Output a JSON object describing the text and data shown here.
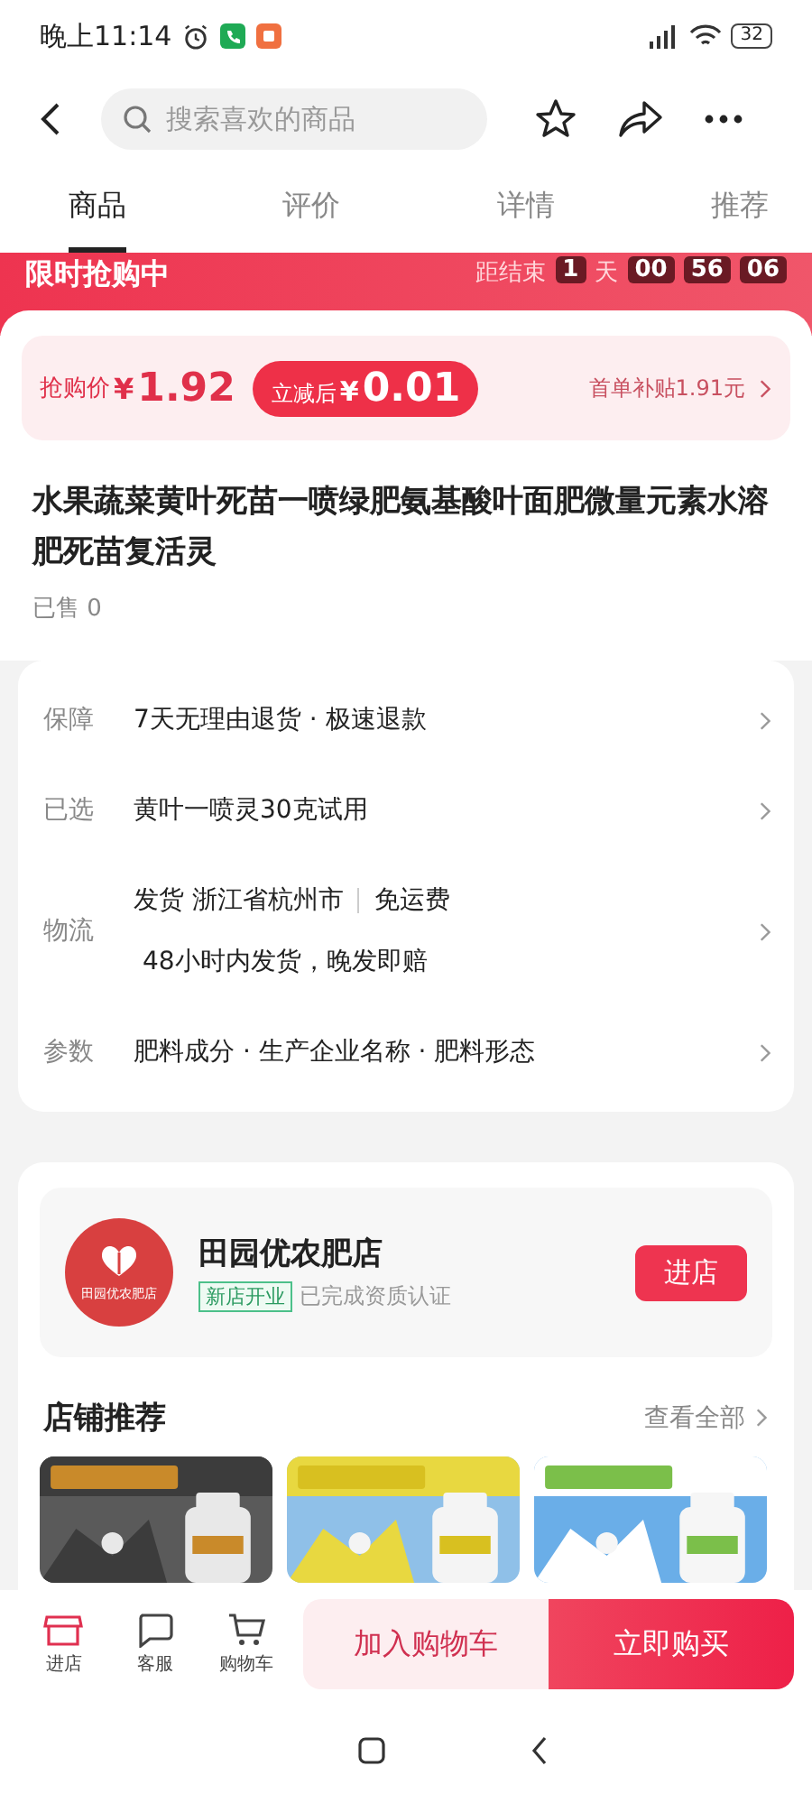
{
  "status_bar": {
    "time": "晚上11:14",
    "battery": "32"
  },
  "header": {
    "search": {
      "placeholder": "搜索喜欢的商品"
    }
  },
  "tabs": [
    {
      "label": "商品",
      "selected": true
    },
    {
      "label": "评价",
      "selected": false
    },
    {
      "label": "详情",
      "selected": false
    },
    {
      "label": "推荐",
      "selected": false
    }
  ],
  "flash_sale": {
    "title": "限时抢购中",
    "ends_label": "距结束",
    "days": "1",
    "days_unit": "天",
    "hours": "00",
    "minutes": "56",
    "seconds": "06"
  },
  "price": {
    "label": "抢购价",
    "currency": "¥",
    "value": "1.92",
    "discount_label": "立减后",
    "discount_currency": "¥",
    "discount_value": "0.01",
    "subsidy": "首单补贴1.91元"
  },
  "product": {
    "title": "水果蔬菜黄叶死苗一喷绿肥氨基酸叶面肥微量元素水溶肥死苗复活灵",
    "sold": "已售 0"
  },
  "info_rows": [
    {
      "label": "保障",
      "lines": [
        "7天无理由退货 · 极速退款"
      ]
    },
    {
      "label": "已选",
      "lines": [
        "黄叶一喷灵30克试用"
      ]
    },
    {
      "label": "物流",
      "lines": [
        "发货 浙江省杭州市",
        "免运费",
        "48小时内发货，晚发即赔"
      ]
    },
    {
      "label": "参数",
      "lines": [
        "肥料成分 · 生产企业名称 · 肥料形态"
      ]
    }
  ],
  "store": {
    "logo_text": "田园优农肥店",
    "name": "田园优农肥店",
    "badge": "新店开业",
    "certification": "已完成资质认证",
    "enter_button": "进店"
  },
  "recommend": {
    "title": "店铺推荐",
    "view_all": "查看全部"
  },
  "bottom_bar": {
    "nav": [
      {
        "label": "进店"
      },
      {
        "label": "客服"
      },
      {
        "label": "购物车"
      }
    ],
    "add_to_cart": "加入购物车",
    "buy_now": "立即购买"
  }
}
